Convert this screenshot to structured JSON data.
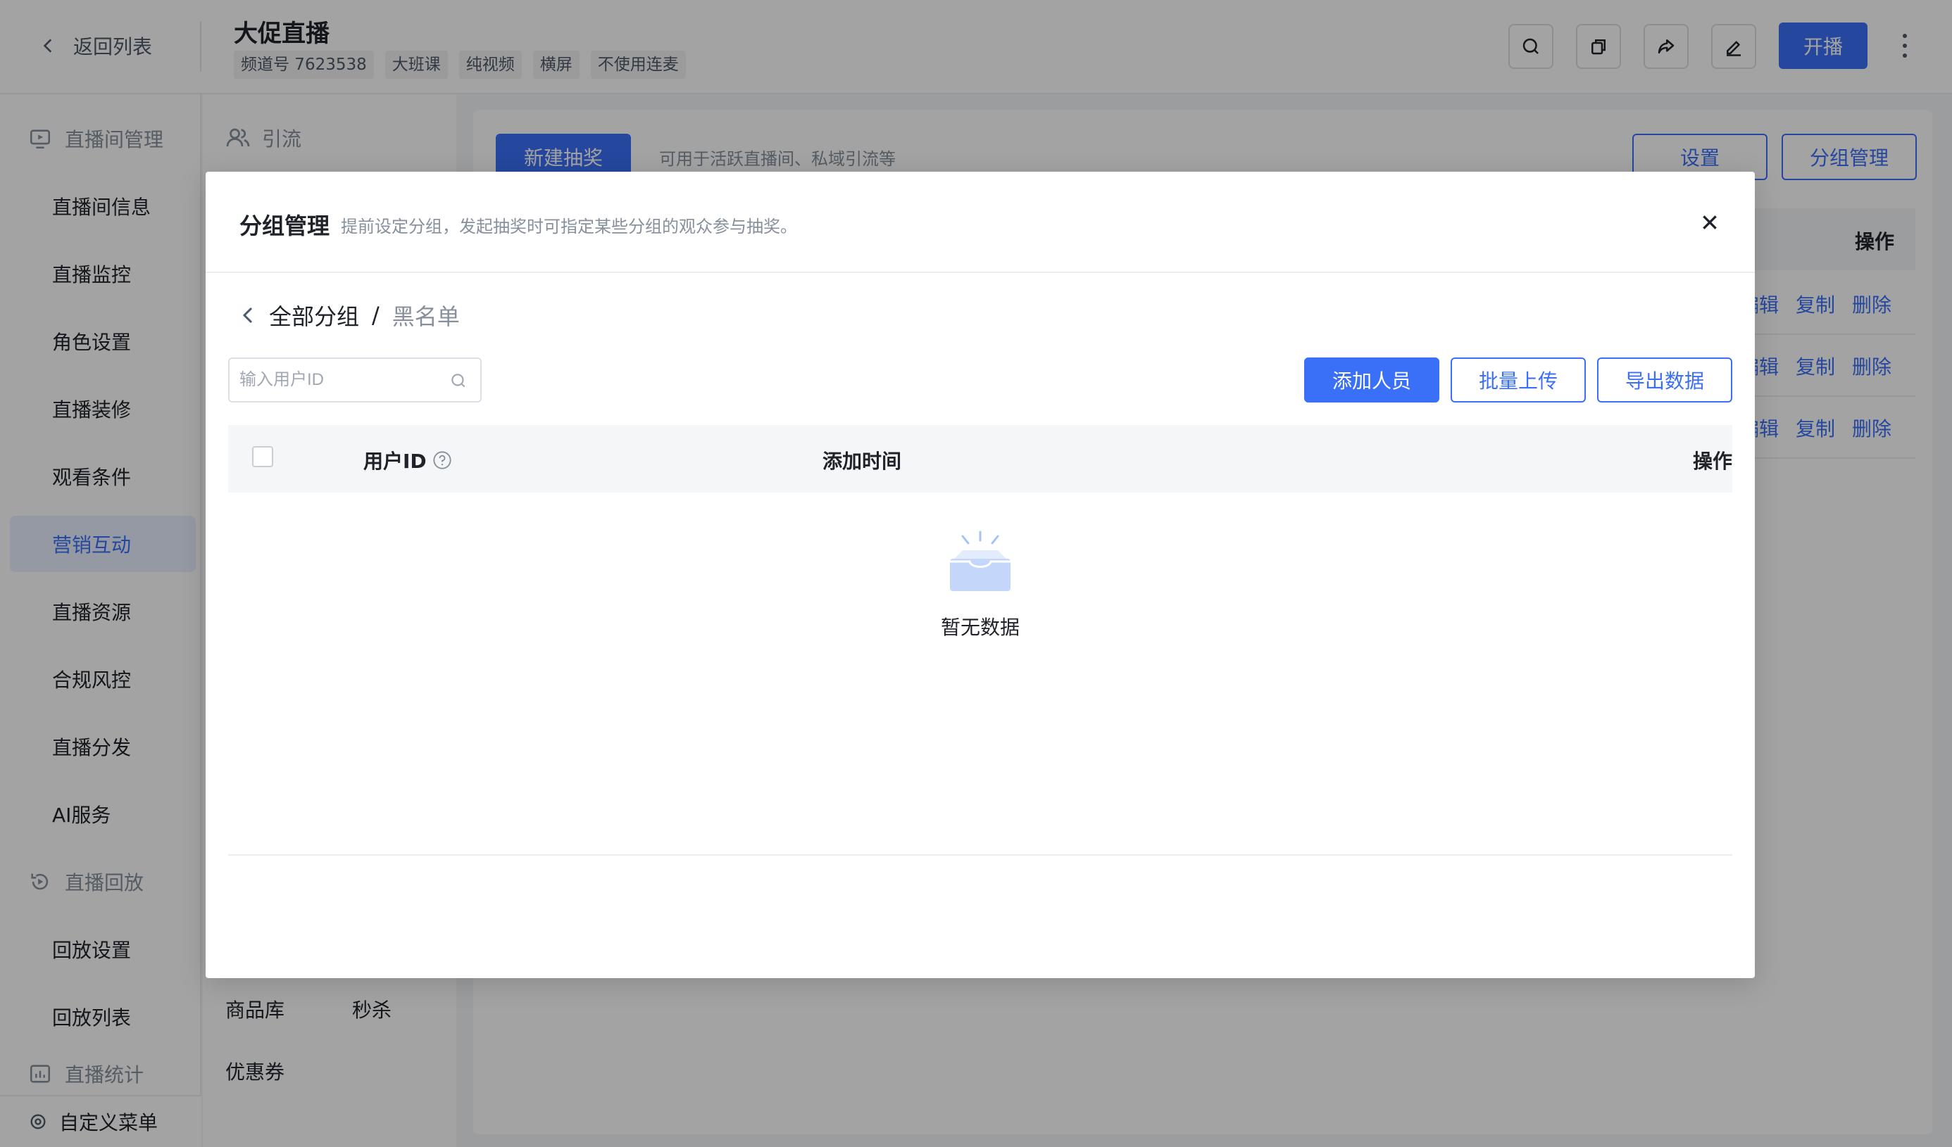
{
  "header": {
    "back_label": "返回列表",
    "title": "大促直播",
    "tags": [
      "频道号 7623538",
      "大班课",
      "纯视频",
      "横屏",
      "不使用连麦"
    ],
    "start_label": "开播",
    "tools": [
      "search-icon",
      "copy-icon",
      "share-icon",
      "edit-icon"
    ]
  },
  "sidebar": {
    "group_live_room": "直播间管理",
    "items": [
      "直播间信息",
      "直播监控",
      "角色设置",
      "直播装修",
      "观看条件",
      "营销互动",
      "直播资源",
      "合规风控",
      "直播分发",
      "AI服务"
    ],
    "active_item": "营销互动",
    "group_playback": "直播回放",
    "playback_items": [
      "回放设置",
      "回放列表"
    ],
    "group_stats": "直播统计",
    "footer_label": "自定义菜单"
  },
  "subnav": {
    "group_label": "引流",
    "links": [
      "商品库",
      "秒杀",
      "优惠券"
    ]
  },
  "content": {
    "new_button": "新建抽奖",
    "hint": "可用于活跃直播间、私域引流等",
    "settings_button": "设置",
    "group_manage_button": "分组管理",
    "op_header": "操作",
    "row_actions": [
      "编辑",
      "复制",
      "删除"
    ]
  },
  "modal": {
    "title": "分组管理",
    "subtitle": "提前设定分组，发起抽奖时可指定某些分组的观众参与抽奖。",
    "breadcrumb_root": "全部分组",
    "breadcrumb_sep": "/",
    "breadcrumb_current": "黑名单",
    "search_placeholder": "输入用户ID",
    "search_value": "",
    "add_button": "添加人员",
    "upload_button": "批量上传",
    "export_button": "导出数据",
    "columns": {
      "user_id": "用户ID",
      "added_time": "添加时间",
      "actions": "操作"
    },
    "empty_text": "暂无数据"
  },
  "colors": {
    "accent": "#3a6ff7",
    "mask": "rgba(0,0,0,0.36)"
  }
}
